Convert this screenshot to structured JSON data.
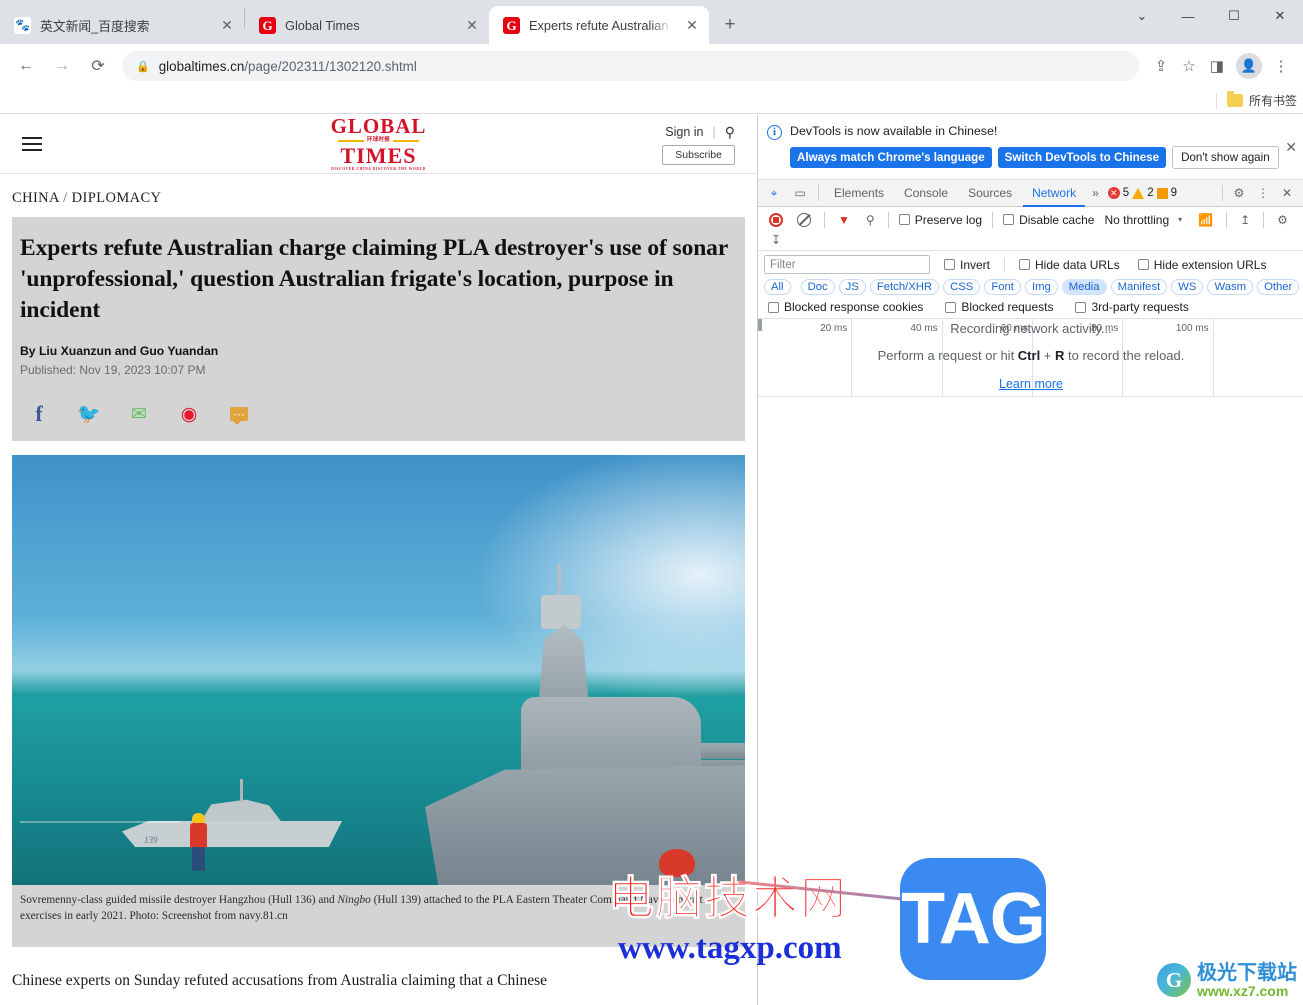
{
  "browser": {
    "tabs": [
      {
        "title": "英文新闻_百度搜索",
        "favicon": "baidu-favicon",
        "active": false,
        "close_label": "✕"
      },
      {
        "title": "Global Times",
        "favicon": "globaltimes-favicon",
        "active": false,
        "close_label": "✕"
      },
      {
        "title": "Experts refute Australian charg",
        "favicon": "globaltimes-favicon",
        "active": true,
        "close_label": "✕"
      }
    ],
    "new_tab_label": "+",
    "window_controls": {
      "dropdown": "⌄",
      "minimize": "—",
      "maximize": "☐",
      "close": "✕"
    },
    "omnibox": {
      "back_icon": "←",
      "forward_icon": "→",
      "reload_icon": "⟳",
      "lock_icon": "🔒",
      "url_domain": "globaltimes.cn",
      "url_path": "/page/202311/1302120.shtml",
      "share_icon": "share-icon",
      "bookmark_icon": "☆",
      "sidepanel_icon": "▯",
      "profile_icon": "👤",
      "menu_icon": "⋮"
    },
    "bookmarks": {
      "all_bookmarks_label": "所有书签",
      "folder_icon": "folder-icon"
    }
  },
  "site": {
    "logo": {
      "line1": "GLOBAL",
      "line2": "TIMES",
      "mid": "环球时报",
      "tagline": "DISCOVER CHINA  DISCOVER THE WORLD"
    },
    "menu_icon": "hamburger-icon",
    "sign_in": "Sign in",
    "divider": "|",
    "search_icon": "⚲",
    "subscribe": "Subscribe",
    "breadcrumb": {
      "section": "CHINA",
      "sep": "/",
      "subsection": "DIPLOMACY"
    },
    "article": {
      "headline": "Experts refute Australian charge claiming PLA destroyer's use of sonar 'unprofessional,' question Australian frigate's location, purpose in incident",
      "byline": "By Liu Xuanzun and Guo Yuandan",
      "published": "Published: Nov 19, 2023 10:07 PM",
      "social": [
        {
          "name": "facebook-icon",
          "glyph": "f"
        },
        {
          "name": "twitter-icon",
          "glyph": "🐦"
        },
        {
          "name": "wechat-icon",
          "glyph": "✆"
        },
        {
          "name": "weibo-icon",
          "glyph": "◉"
        },
        {
          "name": "sms-icon",
          "glyph": "⋯"
        }
      ],
      "photo": {
        "alt": "pla-destroyer-photo",
        "hull_number": "139"
      },
      "caption_part1": "Sovremenny-class guided missile destroyer Hangzhou (Hull 136) and ",
      "caption_italic": "Ningbo",
      "caption_part2": " (Hull 139) attached to the PLA Eastern Theater Command Navy conduct exercises in early 2021. Photo: Screenshot from navy.81.cn",
      "body_first_line": "Chinese experts on Sunday refuted accusations from Australia claiming that a Chinese"
    },
    "scrollbar": {
      "up": "▲",
      "down": "▼"
    }
  },
  "devtools": {
    "banner": {
      "icon": "info-icon",
      "message": "DevTools is now available in Chinese!",
      "primary1": "Always match Chrome's language",
      "primary2": "Switch DevTools to Chinese",
      "dismiss": "Don't show again",
      "close": "✕"
    },
    "tabbar": {
      "inspect_icon": "inspect-element-icon",
      "device_icon": "device-toolbar-icon",
      "tabs": [
        "Elements",
        "Console",
        "Sources",
        "Network"
      ],
      "active_tab": "Network",
      "more_icon": "»",
      "errors": "5",
      "warnings": "2",
      "issues": "9",
      "settings_icon": "⚙",
      "kebab_icon": "⋮",
      "close_icon": "✕"
    },
    "toolbar": {
      "record_icon": "record-button",
      "clear_icon": "clear-button",
      "filter_icon": "filter-funnel-icon",
      "search_icon": "⚲",
      "preserve_log": "Preserve log",
      "disable_cache": "Disable cache",
      "throttling": "No throttling",
      "caret": "▾",
      "wifi_icon": "network-conditions-icon",
      "import_icon": "↥",
      "export_icon": "↧",
      "settings_icon": "⚙"
    },
    "filters": {
      "filter_placeholder": "Filter",
      "filter_value": "",
      "invert": "Invert",
      "hide_data_urls": "Hide data URLs",
      "hide_extension_urls": "Hide extension URLs",
      "types": [
        "All",
        "Doc",
        "JS",
        "Fetch/XHR",
        "CSS",
        "Font",
        "Img",
        "Media",
        "Manifest",
        "WS",
        "Wasm",
        "Other"
      ],
      "selected_type": "Media",
      "blocked_response_cookies": "Blocked response cookies",
      "blocked_requests": "Blocked requests",
      "third_party_requests": "3rd-party requests"
    },
    "timeline": {
      "ticks": [
        "20 ms",
        "40 ms",
        "60 ms",
        "80 ms",
        "100 ms",
        ""
      ]
    },
    "empty_state": {
      "line1": "Recording network activity...",
      "line2_pre": "Perform a request or hit ",
      "line2_key1": "Ctrl",
      "line2_plus": " + ",
      "line2_key2": "R",
      "line2_post": " to record the reload.",
      "learn_more": "Learn more"
    }
  },
  "watermarks": {
    "tag": {
      "cn": "电脑技术网",
      "url": "www.tagxp.com",
      "logo": "TAG"
    },
    "xz": {
      "mark": "G",
      "cn": "极光下载站",
      "url": "www.xz7.com"
    }
  }
}
